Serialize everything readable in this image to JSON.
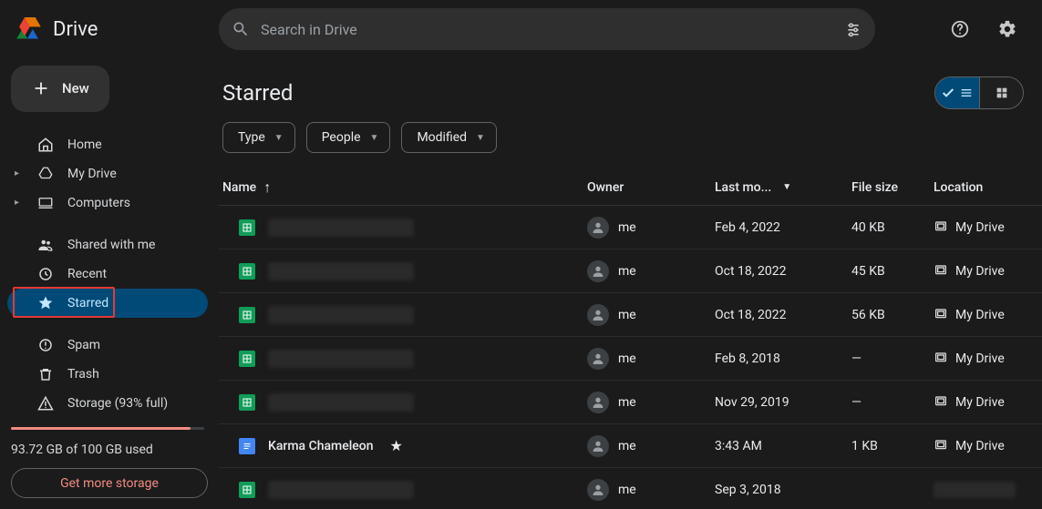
{
  "app": {
    "name": "Drive"
  },
  "search": {
    "placeholder": "Search in Drive"
  },
  "new_button": "New",
  "sidebar": {
    "home": "Home",
    "my_drive": "My Drive",
    "computers": "Computers",
    "shared": "Shared with me",
    "recent": "Recent",
    "starred": "Starred",
    "spam": "Spam",
    "trash": "Trash",
    "storage_label": "Storage (93% full)",
    "storage_used": "93.72 GB of 100 GB used",
    "get_more": "Get more storage"
  },
  "page": {
    "title": "Starred"
  },
  "filters": {
    "type": "Type",
    "people": "People",
    "modified": "Modified"
  },
  "columns": {
    "name": "Name",
    "owner": "Owner",
    "last_modified": "Last mo...",
    "file_size": "File size",
    "location": "Location"
  },
  "owner_me": "me",
  "location_my_drive": "My Drive",
  "rows": [
    {
      "kind": "sheets",
      "name": "",
      "redacted": true,
      "owner": "me",
      "modified": "Feb 4, 2022",
      "size": "40 KB",
      "location": "My Drive"
    },
    {
      "kind": "sheets",
      "name": "",
      "redacted": true,
      "owner": "me",
      "modified": "Oct 18, 2022",
      "size": "45 KB",
      "location": "My Drive"
    },
    {
      "kind": "sheets",
      "name": "",
      "redacted": true,
      "owner": "me",
      "modified": "Oct 18, 2022",
      "size": "56 KB",
      "location": "My Drive"
    },
    {
      "kind": "sheets",
      "name": "",
      "redacted": true,
      "owner": "me",
      "modified": "Feb 8, 2018",
      "size": "—",
      "location": "My Drive"
    },
    {
      "kind": "sheets",
      "name": "",
      "redacted": true,
      "owner": "me",
      "modified": "Nov 29, 2019",
      "size": "—",
      "location": "My Drive"
    },
    {
      "kind": "docs",
      "name": "Karma Chameleon",
      "redacted": false,
      "starred": true,
      "owner": "me",
      "modified": "3:43 AM",
      "size": "1 KB",
      "location": "My Drive"
    },
    {
      "kind": "sheets",
      "name": "",
      "redacted": true,
      "owner": "me",
      "modified": "Sep 3, 2018",
      "size": "",
      "location": "",
      "location_redacted": true
    }
  ]
}
